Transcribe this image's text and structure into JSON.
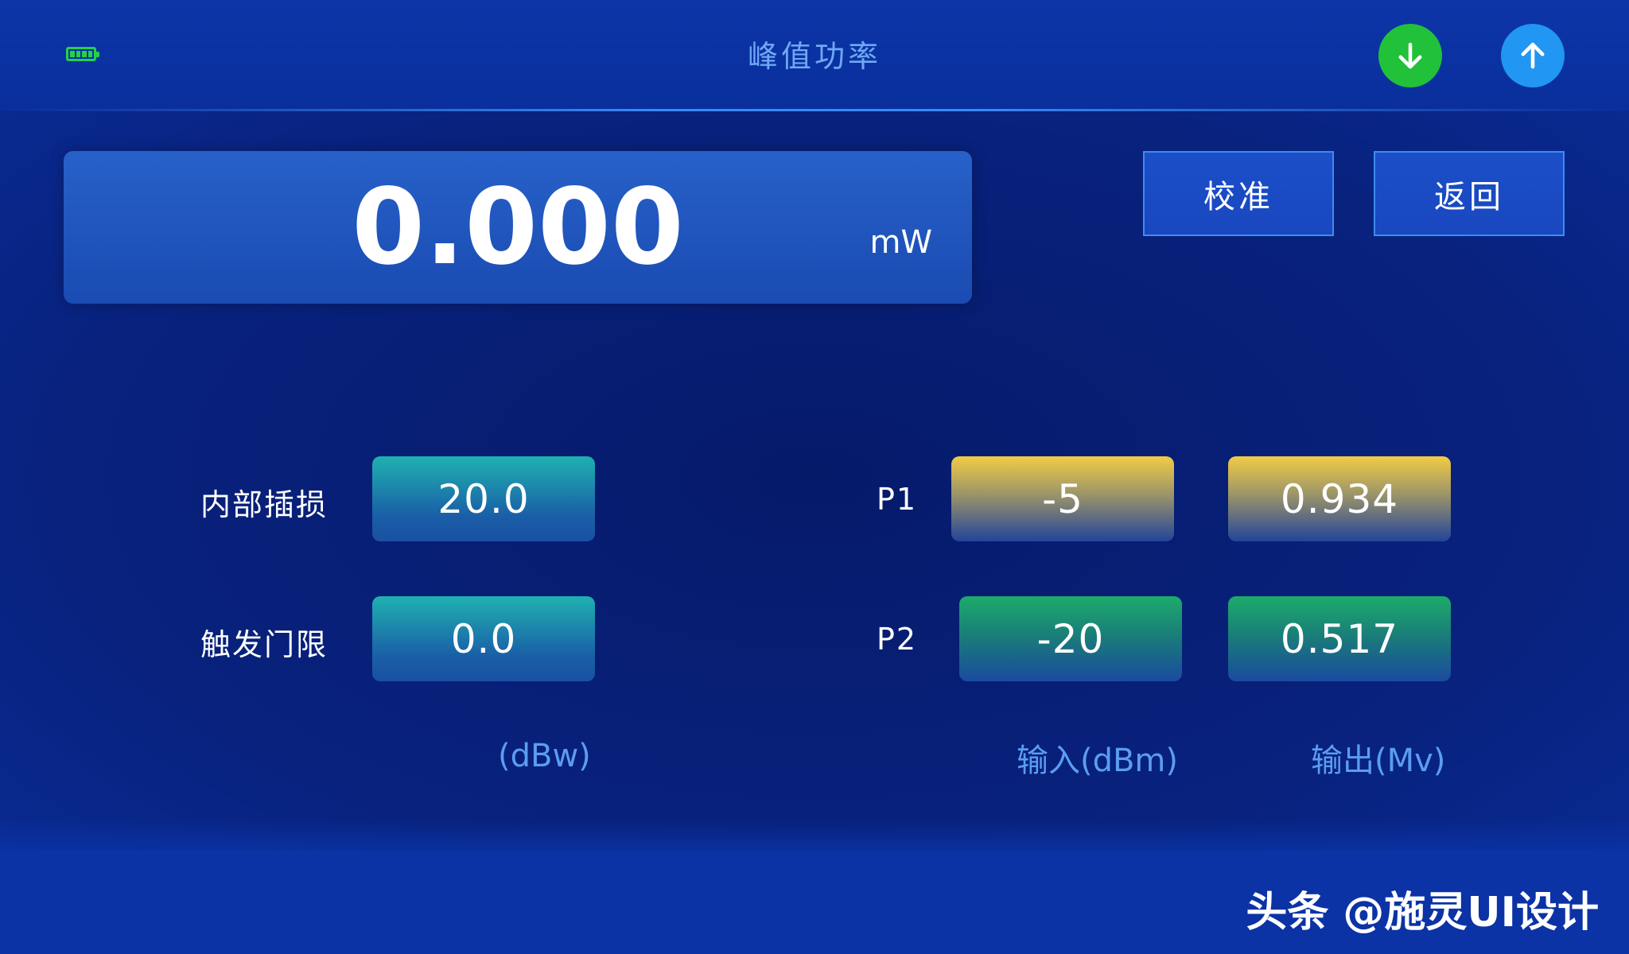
{
  "header": {
    "title": "峰值功率",
    "battery_icon": "battery-icon",
    "download_icon": "arrow-down-icon",
    "upload_icon": "arrow-up-icon",
    "download_color": "#21c13a",
    "upload_color": "#2196f3"
  },
  "display": {
    "value": "0.000",
    "unit": "mW"
  },
  "actions": {
    "calibrate_label": "校准",
    "back_label": "返回"
  },
  "left_params": {
    "insertion_loss_label": "内部插损",
    "insertion_loss_value": "20.0",
    "trigger_threshold_label": "触发门限",
    "trigger_threshold_value": "0.0",
    "unit": "(dBw)"
  },
  "right_params": {
    "p1_label": "P1",
    "p1_input": "-5",
    "p1_output": "0.934",
    "p2_label": "P2",
    "p2_input": "-20",
    "p2_output": "0.517",
    "input_unit": "输入(dBm)",
    "output_unit": "输出(Mv)"
  },
  "watermark": "头条 @施灵UI设计"
}
